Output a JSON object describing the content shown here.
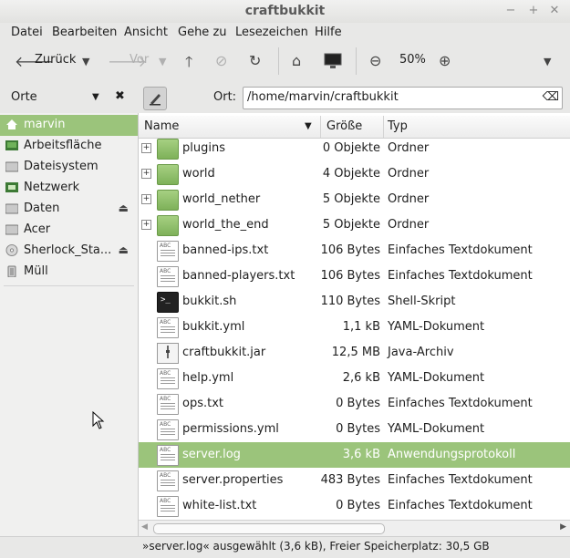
{
  "window": {
    "title": "craftbukkit"
  },
  "menu": [
    "Datei",
    "Bearbeiten",
    "Ansicht",
    "Gehe zu",
    "Lesezeichen",
    "Hilfe"
  ],
  "toolbar": {
    "back_label": "Zurück",
    "forward_label": "Vor",
    "zoom": "50%"
  },
  "location": {
    "label": "Ort:",
    "path": "/home/marvin/craftbukkit"
  },
  "sidebar": {
    "title": "Orte",
    "items": [
      {
        "label": "marvin",
        "icon": "home-icon"
      },
      {
        "label": "Arbeitsfläche",
        "icon": "desktop-icon"
      },
      {
        "label": "Dateisystem",
        "icon": "drive-icon"
      },
      {
        "label": "Netzwerk",
        "icon": "network-icon"
      },
      {
        "label": "Daten",
        "icon": "drive-icon"
      },
      {
        "label": "Acer",
        "icon": "drive-icon"
      },
      {
        "label": "Sherlock_Sta...",
        "icon": "disc-icon"
      },
      {
        "label": "Müll",
        "icon": "trash-icon"
      }
    ]
  },
  "columns": {
    "name": "Name",
    "size": "Größe",
    "type": "Typ"
  },
  "files": [
    {
      "name": "plugins",
      "size": "0 Objekte",
      "type": "Ordner"
    },
    {
      "name": "world",
      "size": "4 Objekte",
      "type": "Ordner"
    },
    {
      "name": "world_nether",
      "size": "5 Objekte",
      "type": "Ordner"
    },
    {
      "name": "world_the_end",
      "size": "5 Objekte",
      "type": "Ordner"
    },
    {
      "name": "banned-ips.txt",
      "size": "106 Bytes",
      "type": "Einfaches Textdokument"
    },
    {
      "name": "banned-players.txt",
      "size": "106 Bytes",
      "type": "Einfaches Textdokument"
    },
    {
      "name": "bukkit.sh",
      "size": "110 Bytes",
      "type": "Shell-Skript"
    },
    {
      "name": "bukkit.yml",
      "size": "1,1 kB",
      "type": "YAML-Dokument"
    },
    {
      "name": "craftbukkit.jar",
      "size": "12,5 MB",
      "type": "Java-Archiv"
    },
    {
      "name": "help.yml",
      "size": "2,6 kB",
      "type": "YAML-Dokument"
    },
    {
      "name": "ops.txt",
      "size": "0 Bytes",
      "type": "Einfaches Textdokument"
    },
    {
      "name": "permissions.yml",
      "size": "0 Bytes",
      "type": "YAML-Dokument"
    },
    {
      "name": "server.log",
      "size": "3,6 kB",
      "type": "Anwendungsprotokoll"
    },
    {
      "name": "server.properties",
      "size": "483 Bytes",
      "type": "Einfaches Textdokument"
    },
    {
      "name": "white-list.txt",
      "size": "0 Bytes",
      "type": "Einfaches Textdokument"
    }
  ],
  "status": "»server.log« ausgewählt (3,6 kB), Freier Speicherplatz: 30,5 GB"
}
